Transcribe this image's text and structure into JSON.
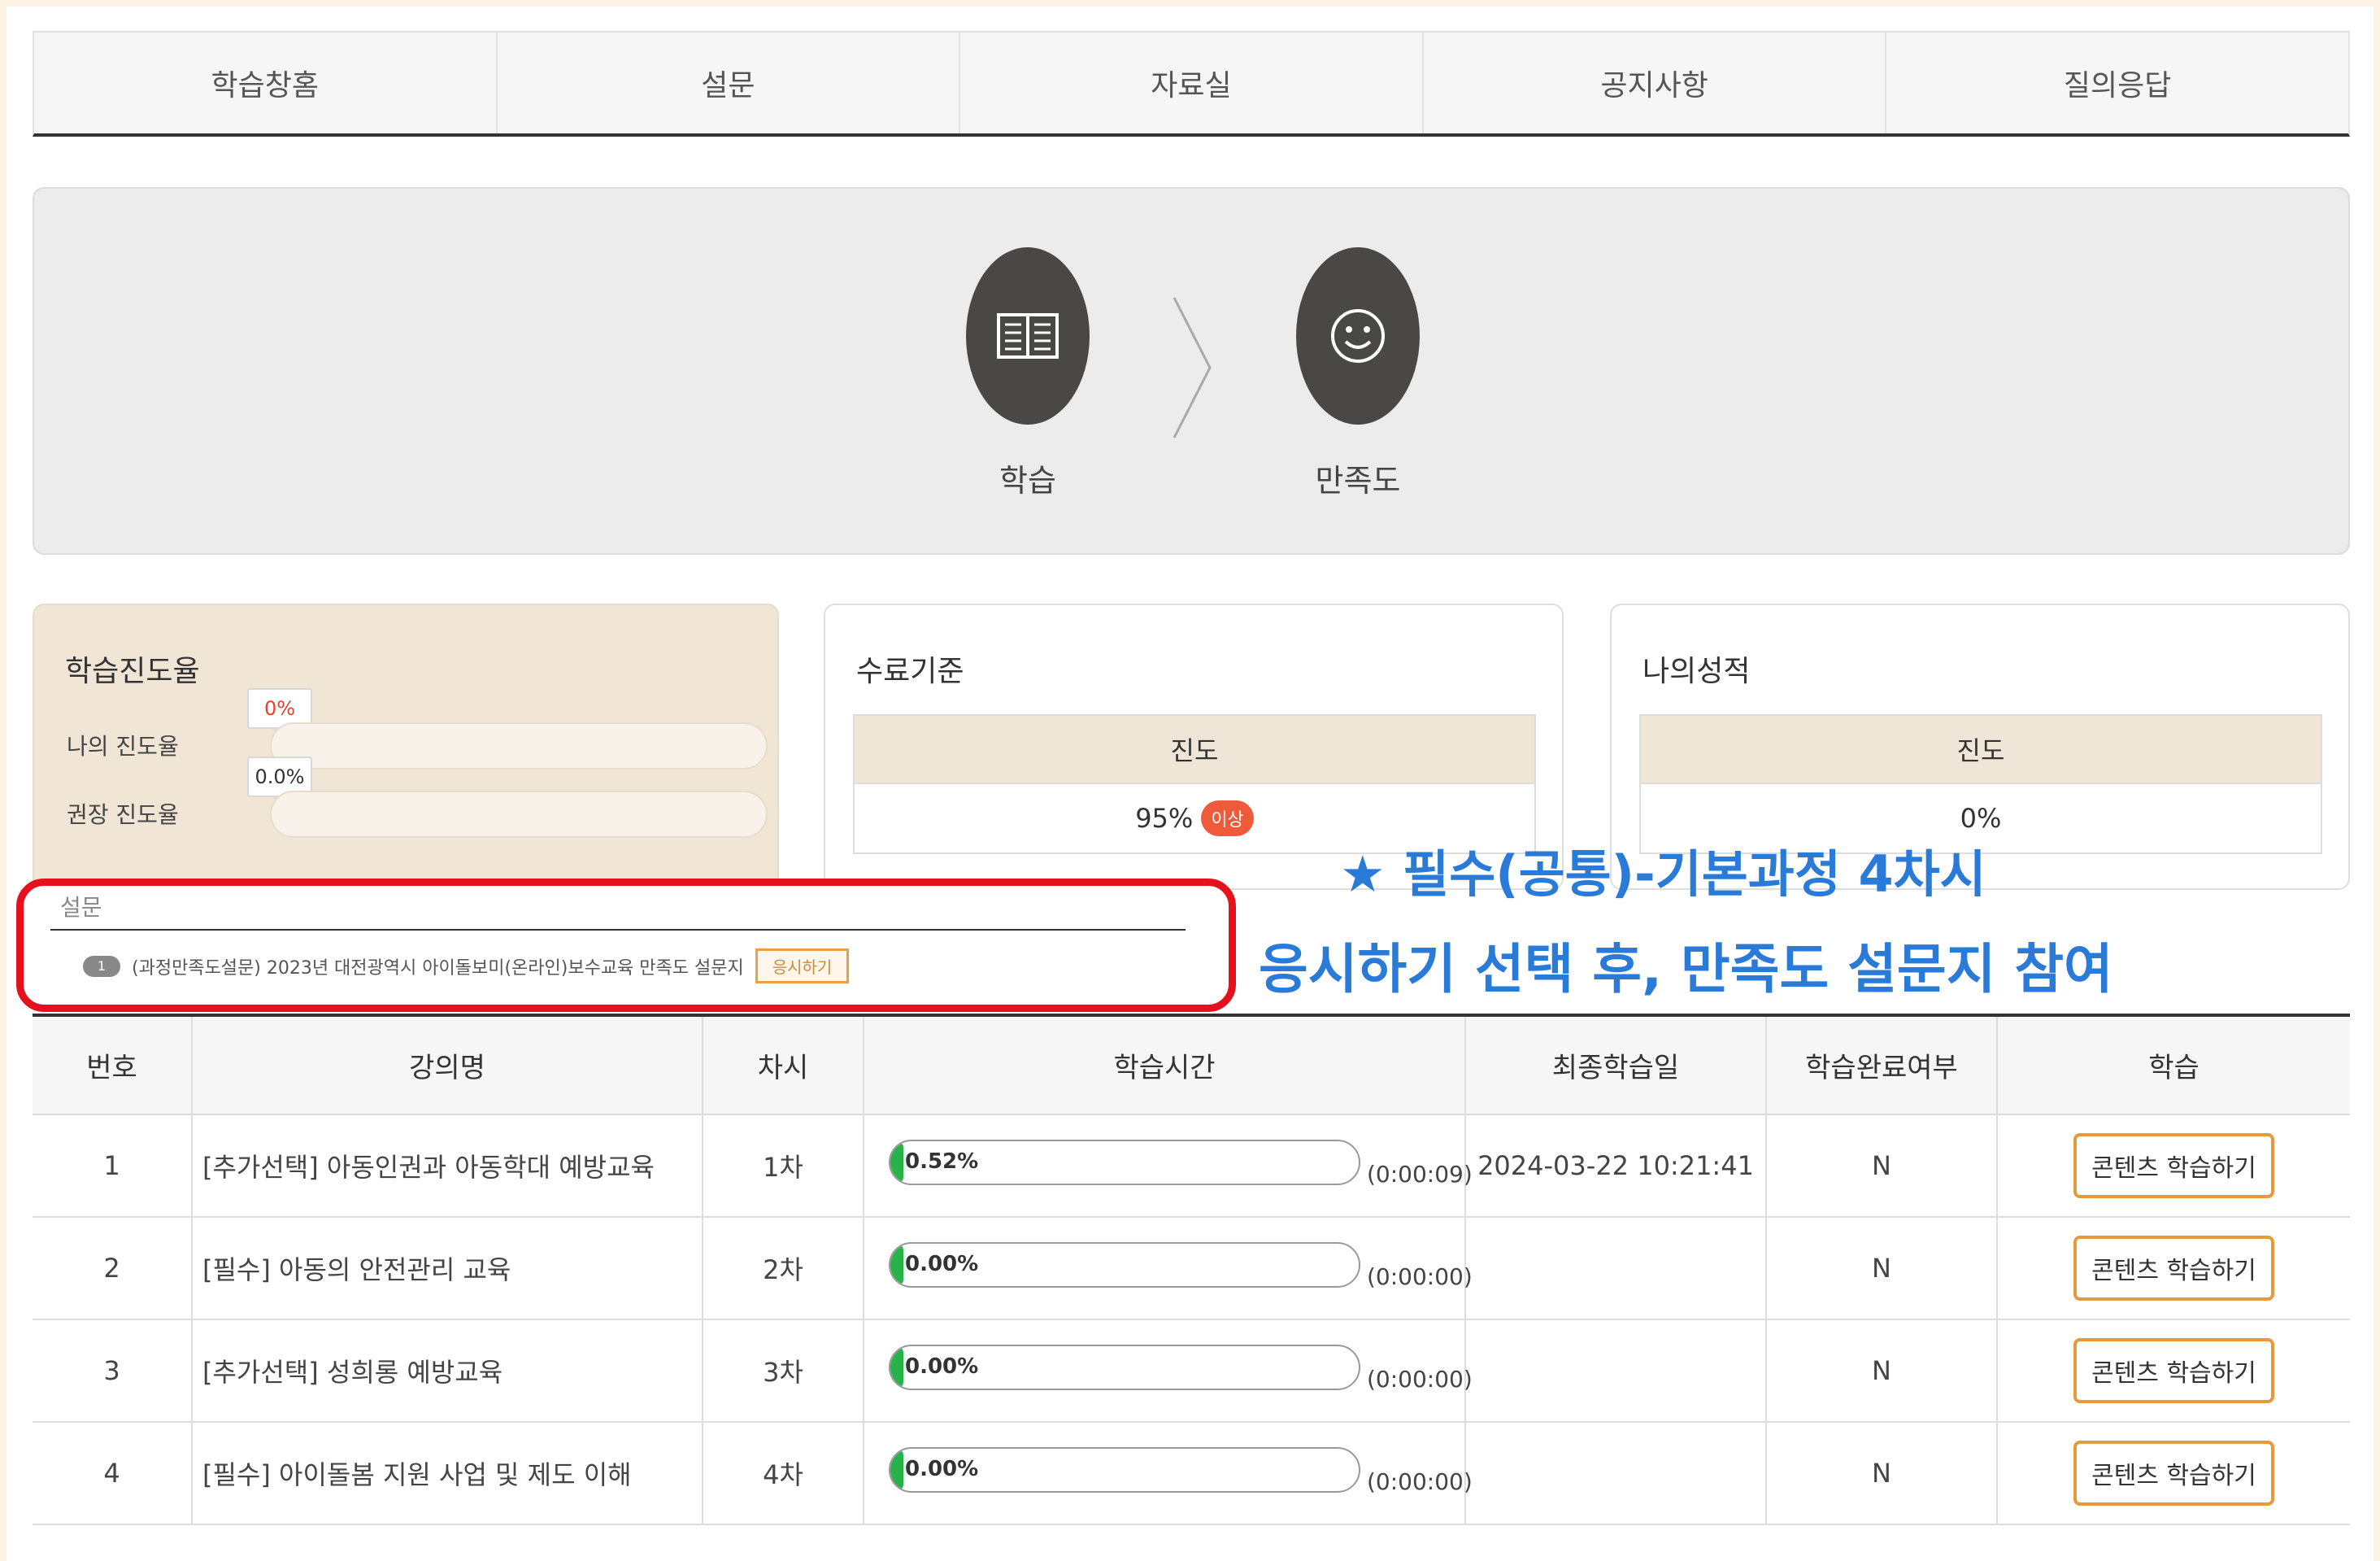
{
  "tabs": [
    "학습창홈",
    "설문",
    "자료실",
    "공지사항",
    "질의응답"
  ],
  "steps": [
    {
      "label": "학습",
      "icon": "book-icon"
    },
    {
      "label": "만족도",
      "icon": "smiley-icon"
    }
  ],
  "progress_panel": {
    "title": "학습진도율",
    "my_label": "나의 진도율",
    "my_value": "0%",
    "my_fraction": 0,
    "recommended_label": "권장 진도율",
    "recommended_value": "0.0%",
    "recommended_fraction": 0
  },
  "criteria_panel": {
    "title": "수료기준",
    "header": "진도",
    "value": "95%",
    "badge": "이상"
  },
  "grade_panel": {
    "title": "나의성적",
    "header": "진도",
    "value": "0%"
  },
  "survey": {
    "title": "설문",
    "number": "1",
    "text": "(과정만족도설문) 2023년 대전광역시 아이돌보미(온라인)보수교육 만족도 설문지",
    "button": "응시하기"
  },
  "callout": {
    "line1": "★ 필수(공통)-기본과정 4차시",
    "line2": "응시하기 선택 후, 만족도 설문지 참여",
    "color": "#2a7bd8"
  },
  "table": {
    "headers": [
      "번호",
      "강의명",
      "차시",
      "학습시간",
      "최종학습일",
      "학습완료여부",
      "학습"
    ],
    "rows": [
      {
        "no": "1",
        "name": "[추가선택] 아동인권과 아동학대 예방교육",
        "session": "1차",
        "percent": "0.52%",
        "duration": "(0:00:09)",
        "last_date": "2024-03-22 10:21:41",
        "complete": "N",
        "button": "콘텐츠 학습하기"
      },
      {
        "no": "2",
        "name": "[필수] 아동의 안전관리 교육",
        "session": "2차",
        "percent": "0.00%",
        "duration": "(0:00:00)",
        "last_date": "",
        "complete": "N",
        "button": "콘텐츠 학습하기"
      },
      {
        "no": "3",
        "name": "[추가선택] 성희롱 예방교육",
        "session": "3차",
        "percent": "0.00%",
        "duration": "(0:00:00)",
        "last_date": "",
        "complete": "N",
        "button": "콘텐츠 학습하기"
      },
      {
        "no": "4",
        "name": "[필수] 아이돌봄 지원 사업 및 제도 이해",
        "session": "4차",
        "percent": "0.00%",
        "duration": "(0:00:00)",
        "last_date": "",
        "complete": "N",
        "button": "콘텐츠 학습하기"
      }
    ]
  }
}
